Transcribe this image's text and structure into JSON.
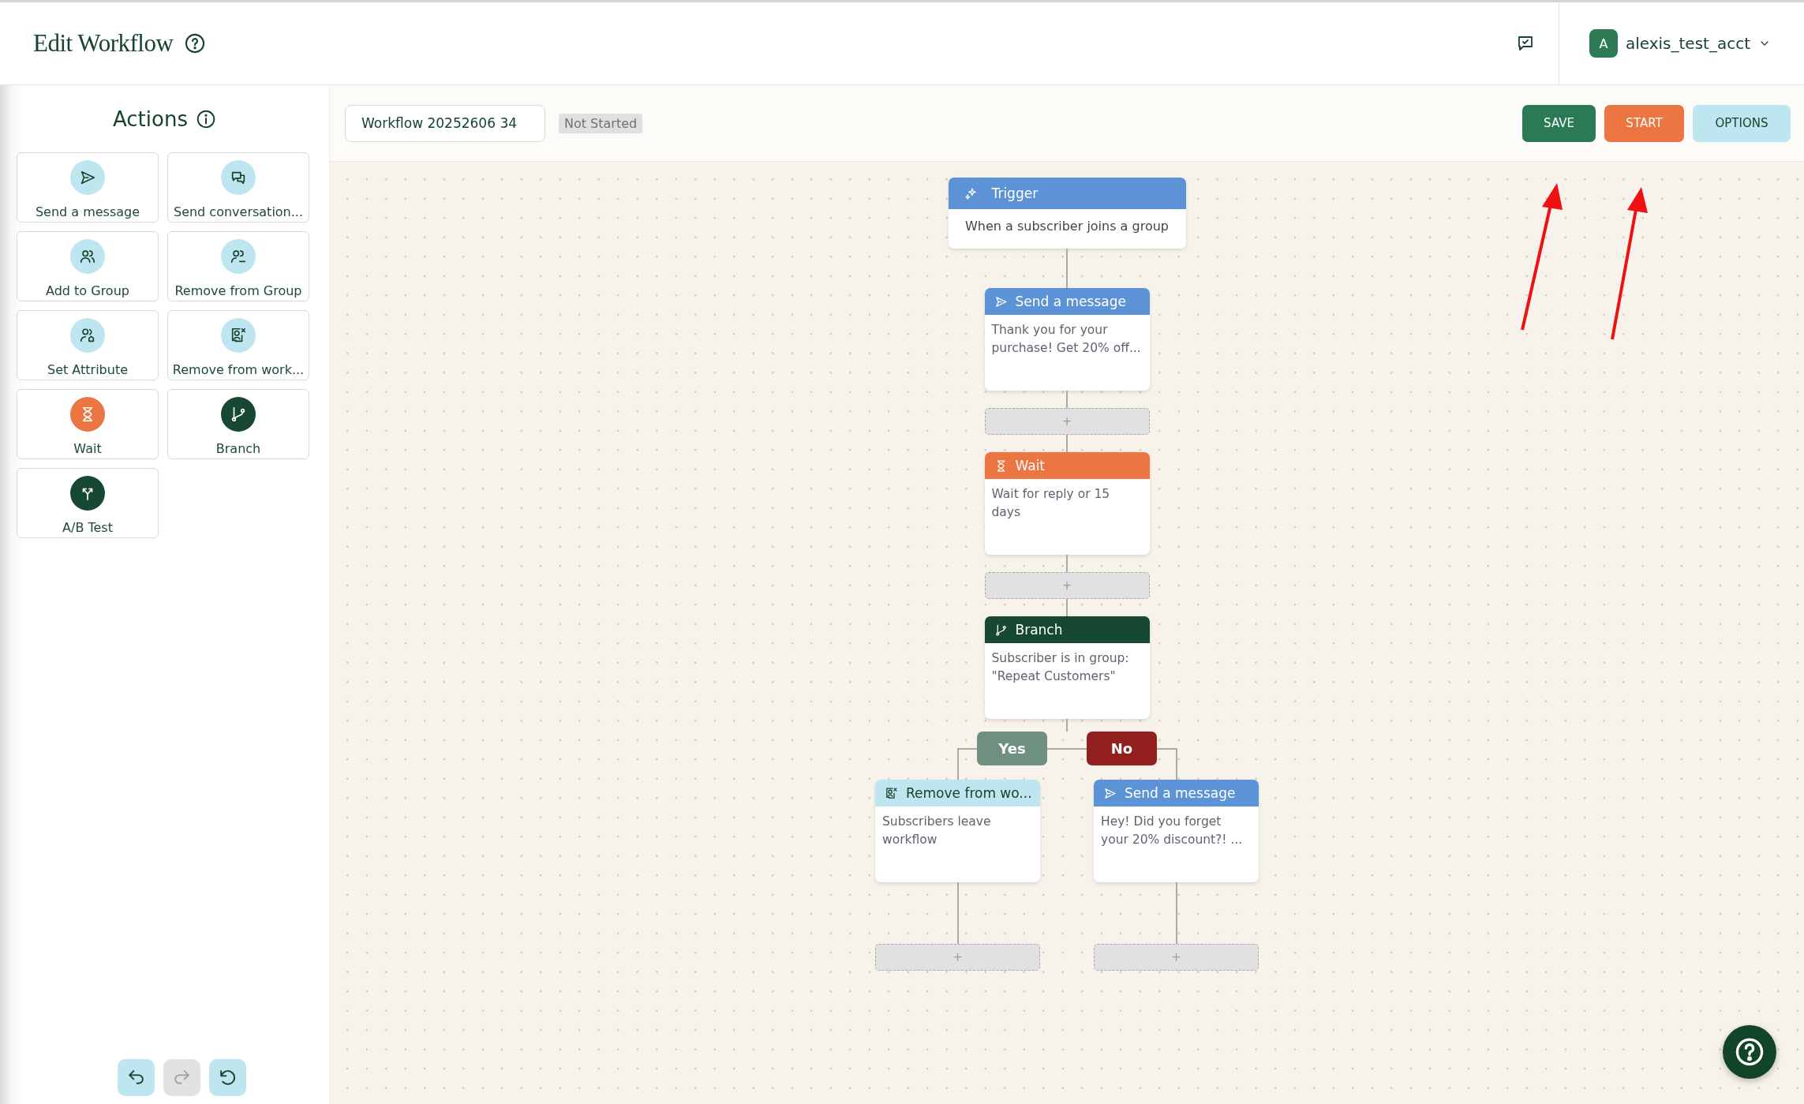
{
  "header": {
    "title": "Edit Workflow",
    "user": {
      "initial": "A",
      "name": "alexis_test_acct"
    }
  },
  "sidebar": {
    "title": "Actions",
    "actions": [
      {
        "label": "Send a message",
        "kind": "send"
      },
      {
        "label": "Send conversation...",
        "kind": "conversation"
      },
      {
        "label": "Add to Group",
        "kind": "add_group"
      },
      {
        "label": "Remove from Group",
        "kind": "remove_group"
      },
      {
        "label": "Set Attribute",
        "kind": "attribute"
      },
      {
        "label": "Remove from work...",
        "kind": "remove_workflow"
      },
      {
        "label": "Wait",
        "kind": "wait"
      },
      {
        "label": "Branch",
        "kind": "branch"
      },
      {
        "label": "A/B Test",
        "kind": "ab_test"
      }
    ]
  },
  "toolbar": {
    "workflow_name": "Workflow 20252606 34",
    "status": "Not Started",
    "buttons": [
      {
        "label": "SAVE",
        "kind": "save"
      },
      {
        "label": "START",
        "kind": "start"
      },
      {
        "label": "OPTIONS",
        "kind": "options"
      }
    ]
  },
  "workflow": {
    "steps": [
      {
        "kind": "trigger",
        "title": "Trigger",
        "text": "When a subscriber joins a group"
      },
      {
        "kind": "send",
        "title": "Send a message",
        "text": "Thank you for your purchase! Get 20% off..."
      },
      {
        "kind": "add",
        "label": "+"
      },
      {
        "kind": "wait",
        "title": "Wait",
        "text": "Wait for reply or 15 days"
      },
      {
        "kind": "add",
        "label": "+"
      },
      {
        "kind": "branch",
        "title": "Branch",
        "text": "Subscriber is in group: \"Repeat Customers\"",
        "branches": [
          {
            "label": "Yes",
            "kind": "yes",
            "steps": [
              {
                "kind": "remove_workflow",
                "title": "Remove from wo...",
                "text": "Subscribers leave workflow"
              },
              {
                "kind": "add",
                "label": "+"
              }
            ]
          },
          {
            "label": "No",
            "kind": "no",
            "steps": [
              {
                "kind": "send",
                "title": "Send a message",
                "text": "Hey! Did you forget your 20% discount?! ..."
              },
              {
                "kind": "add",
                "label": "+"
              }
            ]
          }
        ]
      }
    ]
  }
}
